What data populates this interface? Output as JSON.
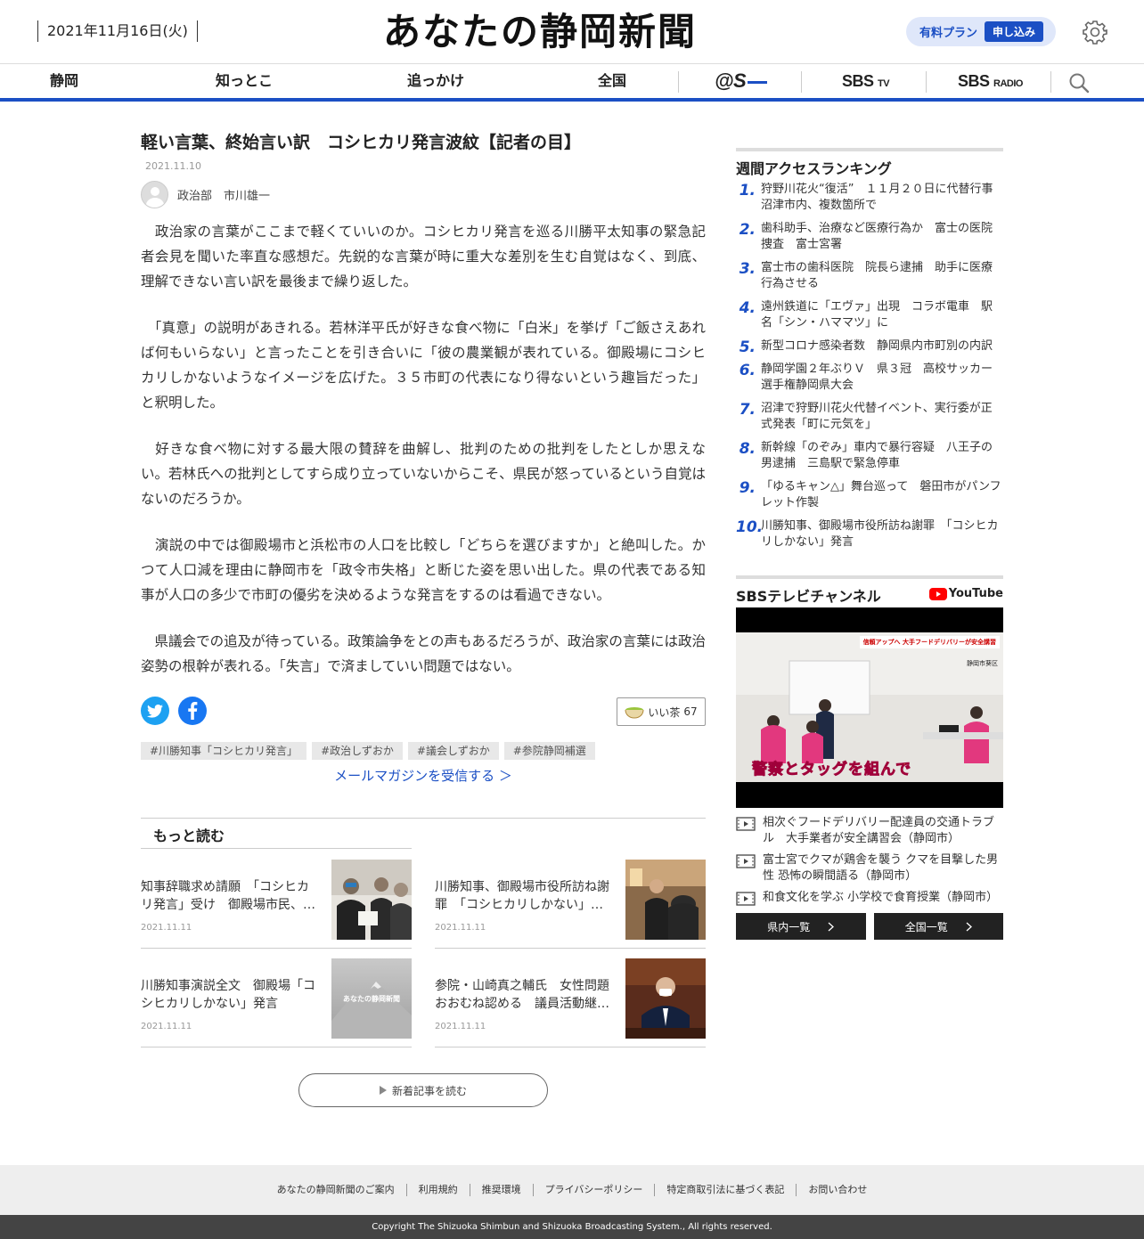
{
  "header": {
    "date": "2021年11月16日(火)",
    "logo": "あなたの静岡新聞",
    "plan_label": "有料プラン",
    "plan_button": "申し込み"
  },
  "nav": {
    "items": [
      "静岡",
      "知っとこ",
      "追っかけ",
      "全国"
    ],
    "atS_label": "@S",
    "sbs_tv": "SBS",
    "sbs_tv_suffix": "TV",
    "sbs_radio": "SBS",
    "sbs_radio_suffix": "RADIO"
  },
  "article": {
    "title": "軽い言葉、終始言い訳　コシヒカリ発言波紋【記者の目】",
    "date": "2021.11.10",
    "author": "政治部　市川雄一",
    "paragraphs": [
      "　政治家の言葉がここまで軽くていいのか。コシヒカリ発言を巡る川勝平太知事の緊急記者会見を聞いた率直な感想だ。先鋭的な言葉が時に重大な差別を生む自覚はなく、到底、理解できない言い訳を最後まで繰り返した。",
      "　「真意」の説明があきれる。若林洋平氏が好きな食べ物に「白米」を挙げ「ご飯さえあれば何もいらない」と言ったことを引き合いに「彼の農業観が表れている。御殿場にコシヒカリしかないようなイメージを広げた。３５市町の代表になり得ないという趣旨だった」と釈明した。",
      "　好きな食べ物に対する最大限の賛辞を曲解し、批判のための批判をしたとしか思えない。若林氏への批判としてすら成り立っていないからこそ、県民が怒っているという自覚はないのだろうか。",
      "　演説の中では御殿場市と浜松市の人口を比較し「どちらを選びますか」と絶叫した。かつて人口減を理由に静岡市を「政令市失格」と断じた姿を思い出した。県の代表である知事が人口の多少で市町の優劣を決めるような発言をするのは看過できない。",
      "　県議会での追及が待っている。政策論争をとの声もあるだろうが、政治家の言葉には政治姿勢の根幹が表れる。「失言」で済ましていい問題ではない。"
    ],
    "tea_label": "いい茶",
    "tea_count": "67",
    "tags": [
      "#川勝知事「コシヒカリ発言」",
      "#政治しずおか",
      "#議会しずおか",
      "#参院静岡補選"
    ],
    "mail_link": "メールマガジンを受信する ＞"
  },
  "more": {
    "heading": "もっと読む",
    "cards": [
      {
        "title": "知事辞職求め請願　「コシヒカリ発言」受け　御殿場市民、県議会に",
        "date": "2021.11.11"
      },
      {
        "title": "川勝知事、御殿場市役所訪ね謝罪　「コシヒカリしかない」発言",
        "date": "2021.11.11"
      },
      {
        "title": "川勝知事演説全文　御殿場「コシヒカリしかない」発言",
        "date": "2021.11.11"
      },
      {
        "title": "参院・山崎真之輔氏　女性問題おおむね認める　議員活動継続の意向",
        "date": "2021.11.11"
      }
    ],
    "placeholder_logo": "あなたの静岡新聞",
    "read_more": "新着記事を読む"
  },
  "ranking": {
    "heading": "週間アクセスランキング",
    "items": [
      {
        "n": "1.",
        "t": "狩野川花火“復活”　１１月２０日に代替行事　沼津市内、複数箇所で"
      },
      {
        "n": "2.",
        "t": "歯科助手、治療など医療行為か　富士の医院捜査　富士宮署"
      },
      {
        "n": "3.",
        "t": "富士市の歯科医院　院長ら逮捕　助手に医療行為させる"
      },
      {
        "n": "4.",
        "t": "遠州鉄道に「エヴァ」出現　コラボ電車　駅名「シン・ハママツ」に"
      },
      {
        "n": "5.",
        "t": "新型コロナ感染者数　静岡県内市町別の内訳"
      },
      {
        "n": "6.",
        "t": "静岡学園２年ぶりＶ　県３冠　高校サッカー選手権静岡県大会"
      },
      {
        "n": "7.",
        "t": "沼津で狩野川花火代替イベント、実行委が正式発表「町に元気を」"
      },
      {
        "n": "8.",
        "t": "新幹線「のぞみ」車内で暴行容疑　八王子の男逮捕　三島駅で緊急停車"
      },
      {
        "n": "9.",
        "t": "「ゆるキャン△」舞台巡って　磐田市がパンフレット作製"
      },
      {
        "n": "10.",
        "t": "川勝知事、御殿場市役所訪ね謝罪　「コシヒカリしかない」発言"
      }
    ]
  },
  "tv": {
    "heading": "SBSテレビチャンネル",
    "youtube": "YouTube",
    "video_caption_top": "信頼アップへ 大手フードデリバリーが安全講習",
    "video_caption_sub": "静岡市葵区",
    "video_caption_main": "警察とタッグを組んで",
    "videos": [
      "相次ぐフードデリバリー配達員の交通トラブル　大手業者が安全講習会（静岡市）",
      "富士宮でクマが鶏舎を襲う クマを目撃した男性 恐怖の瞬間語る（静岡市）",
      "和食文化を学ぶ 小学校で食育授業（静岡市）"
    ],
    "btn_local": "県内一覧",
    "btn_national": "全国一覧"
  },
  "footer": {
    "links": [
      "あなたの静岡新聞のご案内",
      "利用規約",
      "推奨環境",
      "プライバシーポリシー",
      "特定商取引法に基づく表記",
      "お問い合わせ"
    ],
    "copyright": "Copyright The Shizuoka Shimbun and Shizuoka Broadcasting System., All rights reserved."
  },
  "colors": {
    "accent": "#1b4fc4",
    "twitter": "#1da1f2",
    "facebook": "#1877f2"
  }
}
